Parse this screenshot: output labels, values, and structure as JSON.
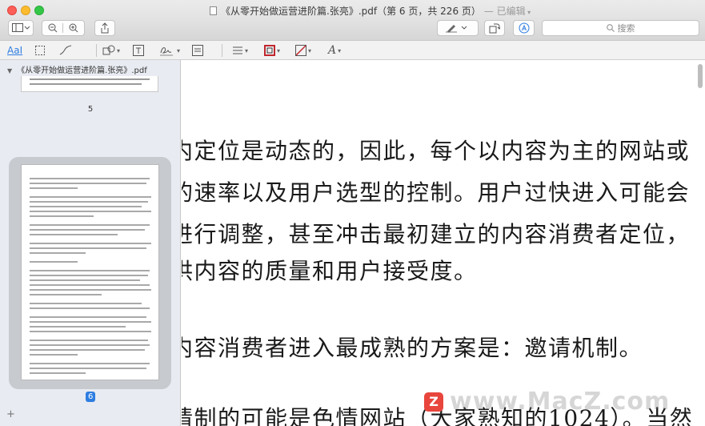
{
  "window": {
    "title_file": "《从零开始做运营进阶篇.张亮》.pdf",
    "title_pages": "（第 6 页，共 226 页）",
    "title_sep": "—",
    "title_status": "已编辑"
  },
  "toolbar": {
    "search_placeholder": "搜索"
  },
  "markup": {
    "text_tool_label": "AaI"
  },
  "sidebar": {
    "doc_name": "《从零开始做运营进阶篇.张亮》.pdf",
    "pages": [
      {
        "label": "5"
      },
      {
        "label": "6",
        "selected": true
      }
    ],
    "add_label": "+"
  },
  "document": {
    "lines": [
      "内定位是动态的，因此，每个以内容为主的网站或",
      "的速率以及用户选型的控制。用户过快进入可能会",
      "进行调整，甚至冲击最初建立的内容消费者定位，",
      "供内容的质量和用户接受度。",
      "内容消费者进入最成熟的方案是：邀请机制。",
      "请制的可能是色情网站（大家熟知的1024）。当然"
    ]
  },
  "watermark": {
    "logo": "Z",
    "text": "www.MacZ.com"
  },
  "colors": {
    "accent": "#2e7de1",
    "close": "#fc5f57",
    "minimize": "#fdbc2e",
    "maximize": "#33c748",
    "markup_red": "#c0262d"
  }
}
